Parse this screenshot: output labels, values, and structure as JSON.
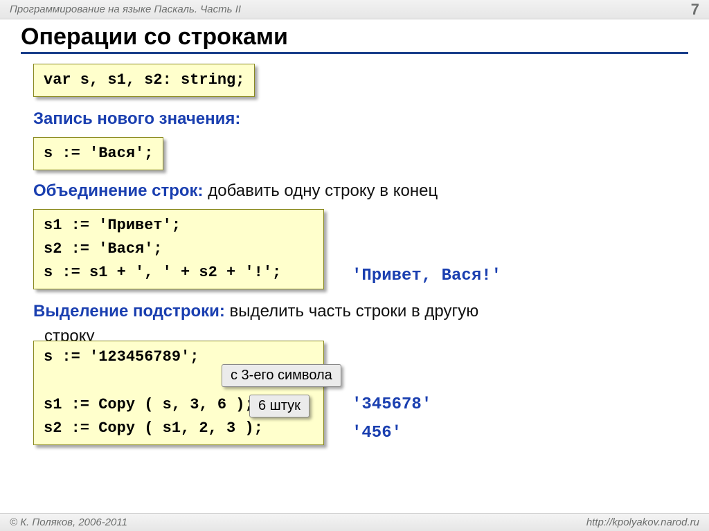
{
  "header": {
    "title": "Программирование на языке Паскаль. Часть II",
    "page": "7"
  },
  "title": "Операции со строками",
  "decl_code": "var s, s1, s2: string;",
  "sect1": {
    "label": "Запись нового значения:",
    "code": "s := 'Вася';"
  },
  "sect2": {
    "label": "Объединение строк:",
    "text": " добавить одну строку в конец",
    "code1": "s1 := 'Привет';",
    "code2": "s2 := 'Вася';",
    "code3": "s := s1 + ', ' + s2 + '!';",
    "result": "'Привет, Вася!'"
  },
  "sect3": {
    "label": "Выделение подстроки:",
    "text": " выделить часть строки в другую",
    "text2": "строку",
    "code1": "s := '123456789';",
    "code2": "s1 := Copy ( s, 3, 6 );",
    "code3": "s2 := Copy ( s1, 2, 3 );",
    "callout1": "с 3-его символа",
    "callout2": "6 штук",
    "result1": "'345678'",
    "result2": "'456'"
  },
  "footer": {
    "left": "© К. Поляков, 2006-2011",
    "right": "http://kpolyakov.narod.ru"
  }
}
